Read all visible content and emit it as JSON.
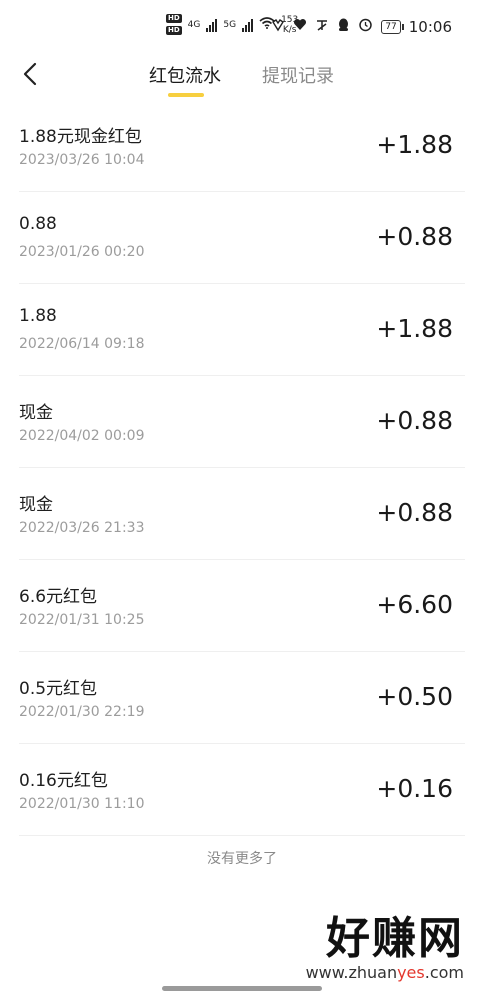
{
  "status_bar": {
    "hd_top": "HD",
    "hd_bottom": "HD",
    "net1": "4G",
    "net2": "5G",
    "speed_value": "153",
    "speed_unit": "K/s",
    "battery": "77",
    "time": "10:06"
  },
  "nav": {
    "tabs": [
      {
        "label": "红包流水",
        "active": true
      },
      {
        "label": "提现记录",
        "active": false
      }
    ],
    "accent_color": "#f7cf3f"
  },
  "records": [
    {
      "title": "1.88元现金红包",
      "time": "2023/03/26 10:04",
      "amount": "+1.88"
    },
    {
      "title": "0.88",
      "time": "2023/01/26 00:20",
      "amount": "+0.88"
    },
    {
      "title": "1.88",
      "time": "2022/06/14 09:18",
      "amount": "+1.88"
    },
    {
      "title": "现金",
      "time": "2022/04/02 00:09",
      "amount": "+0.88"
    },
    {
      "title": "现金",
      "time": "2022/03/26 21:33",
      "amount": "+0.88"
    },
    {
      "title": "6.6元红包",
      "time": "2022/01/31 10:25",
      "amount": "+6.60"
    },
    {
      "title": "0.5元红包",
      "time": "2022/01/30 22:19",
      "amount": "+0.50"
    },
    {
      "title": "0.16元红包",
      "time": "2022/01/30 11:10",
      "amount": "+0.16"
    }
  ],
  "footer_note": "没有更多了",
  "watermark": {
    "main": "好赚网",
    "domain_prefix": "www.zhuan",
    "domain_accent": "yes",
    "domain_suffix": ".com"
  }
}
